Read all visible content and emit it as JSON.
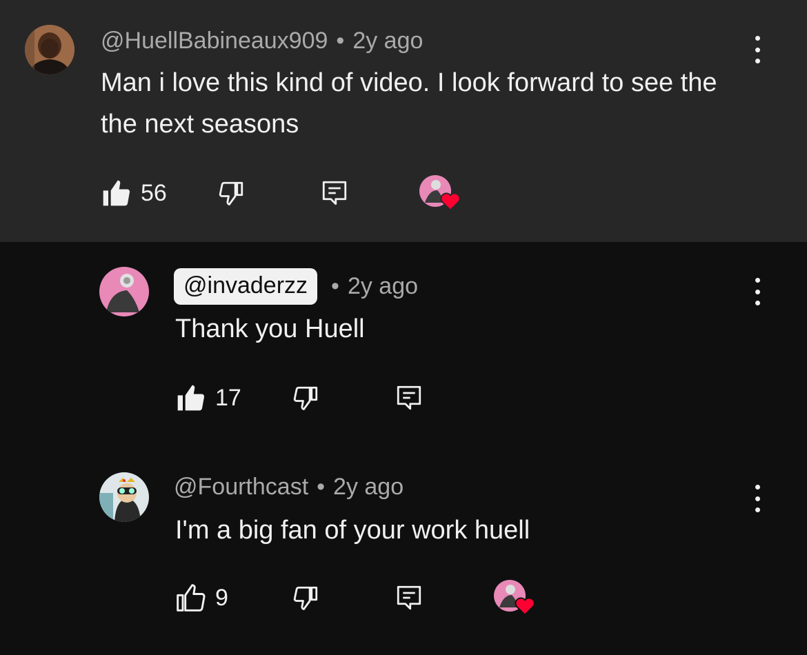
{
  "comments": [
    {
      "author": "@HuellBabineaux909",
      "separator": "•",
      "time": "2y ago",
      "text": "Man i love this kind of video. I look forward to see the the next seasons",
      "likes": "56",
      "liked": true,
      "hearted": true,
      "avatar_icon": "person-avatar"
    },
    {
      "author": "@invaderzz",
      "separator": "•",
      "time": "2y ago",
      "text": "Thank you Huell",
      "likes": "17",
      "liked": true,
      "hearted": false,
      "creator_badge": true,
      "avatar_icon": "pink-figure-avatar"
    },
    {
      "author": "@Fourthcast",
      "separator": "•",
      "time": "2y ago",
      "text": "I'm a big fan of your work huell",
      "likes": "9",
      "liked": false,
      "hearted": true,
      "avatar_icon": "goggles-character-avatar"
    }
  ],
  "colors": {
    "background": "#0f0f0f",
    "highlight_background": "#272727",
    "text": "#f1f1f1",
    "muted": "#aaaaaa",
    "heart": "#ff0033",
    "avatar_pink": "#e889b8"
  },
  "icons": [
    "like-icon",
    "dislike-icon",
    "reply-icon",
    "more-icon",
    "heart-icon"
  ]
}
